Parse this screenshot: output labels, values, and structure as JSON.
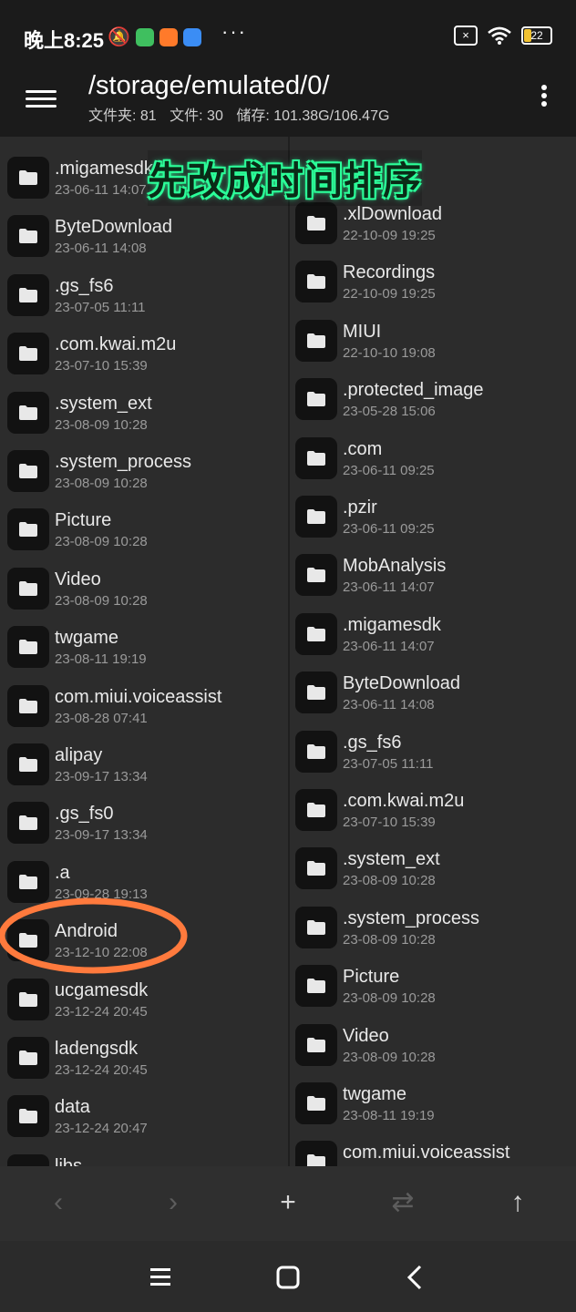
{
  "status_bar": {
    "time": "晚上8:25",
    "dots": "···",
    "battery": "22"
  },
  "header": {
    "path": "/storage/emulated/0/",
    "folders_label": "文件夹: 81",
    "files_label": "文件: 30",
    "storage_label": "储存: 101.38G/106.47G"
  },
  "overlay": {
    "text": "先改成时间排序"
  },
  "left_pane": [
    {
      "name": ".migamesdk",
      "date": "23-06-11 14:07"
    },
    {
      "name": "ByteDownload",
      "date": "23-06-11 14:08"
    },
    {
      "name": ".gs_fs6",
      "date": "23-07-05 11:11"
    },
    {
      "name": ".com.kwai.m2u",
      "date": "23-07-10 15:39"
    },
    {
      "name": ".system_ext",
      "date": "23-08-09 10:28"
    },
    {
      "name": ".system_process",
      "date": "23-08-09 10:28"
    },
    {
      "name": "Picture",
      "date": "23-08-09 10:28"
    },
    {
      "name": "Video",
      "date": "23-08-09 10:28"
    },
    {
      "name": "twgame",
      "date": "23-08-11 19:19"
    },
    {
      "name": "com.miui.voiceassist",
      "date": "23-08-28 07:41"
    },
    {
      "name": "alipay",
      "date": "23-09-17 13:34"
    },
    {
      "name": ".gs_fs0",
      "date": "23-09-17 13:34"
    },
    {
      "name": ".a",
      "date": "23-09-28 19:13"
    },
    {
      "name": "Android",
      "date": "23-12-10 22:08"
    },
    {
      "name": "ucgamesdk",
      "date": "23-12-24 20:45"
    },
    {
      "name": "ladengsdk",
      "date": "23-12-24 20:45"
    },
    {
      "name": "data",
      "date": "23-12-24 20:47"
    },
    {
      "name": "libs",
      "date": ""
    }
  ],
  "right_pane": [
    {
      "name": ".xlDownload",
      "date": "22-10-09 19:25"
    },
    {
      "name": "Recordings",
      "date": "22-10-09 19:25"
    },
    {
      "name": "MIUI",
      "date": "22-10-10 19:08"
    },
    {
      "name": ".protected_image",
      "date": "23-05-28 15:06"
    },
    {
      "name": ".com",
      "date": "23-06-11 09:25"
    },
    {
      "name": ".pzir",
      "date": "23-06-11 09:25"
    },
    {
      "name": "MobAnalysis",
      "date": "23-06-11 14:07"
    },
    {
      "name": ".migamesdk",
      "date": "23-06-11 14:07"
    },
    {
      "name": "ByteDownload",
      "date": "23-06-11 14:08"
    },
    {
      "name": ".gs_fs6",
      "date": "23-07-05 11:11"
    },
    {
      "name": ".com.kwai.m2u",
      "date": "23-07-10 15:39"
    },
    {
      "name": ".system_ext",
      "date": "23-08-09 10:28"
    },
    {
      "name": ".system_process",
      "date": "23-08-09 10:28"
    },
    {
      "name": "Picture",
      "date": "23-08-09 10:28"
    },
    {
      "name": "Video",
      "date": "23-08-09 10:28"
    },
    {
      "name": "twgame",
      "date": "23-08-11 19:19"
    },
    {
      "name": "com.miui.voiceassist",
      "date": ""
    }
  ],
  "toolbar": {
    "back_glyph": "‹",
    "forward_glyph": "›",
    "add_glyph": "+",
    "swap_glyph": "⇄",
    "up_glyph": "↑"
  },
  "colors": {
    "accent_overlay": "#2dff9a",
    "annotation_circle": "#ff7a3d",
    "background": "#2c2c2c",
    "bar": "#1b1b1b"
  }
}
